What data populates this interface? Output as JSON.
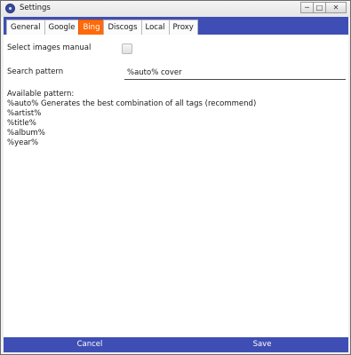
{
  "window": {
    "title": "Settings",
    "min_glyph": "─",
    "max_glyph": "□",
    "close_glyph": "✕"
  },
  "tabs": [
    {
      "label": "General",
      "active": false
    },
    {
      "label": "Google",
      "active": false
    },
    {
      "label": "Bing",
      "active": true
    },
    {
      "label": "Discogs",
      "active": false
    },
    {
      "label": "Local",
      "active": false
    },
    {
      "label": "Proxy",
      "active": false
    }
  ],
  "bing": {
    "select_images_manual_label": "Select images manual",
    "select_images_manual_checked": false,
    "search_pattern_label": "Search pattern",
    "search_pattern_value": "%auto% cover",
    "available_pattern_title": "Available pattern:",
    "patterns": [
      "%auto% Generates the best combination of all tags (recommend)",
      "%artist%",
      "%title%",
      "%album%",
      "%year%"
    ]
  },
  "footer": {
    "cancel_label": "Cancel",
    "save_label": "Save"
  },
  "colors": {
    "accent": "#3f4eb4",
    "active_tab": "#ff6a0a"
  }
}
